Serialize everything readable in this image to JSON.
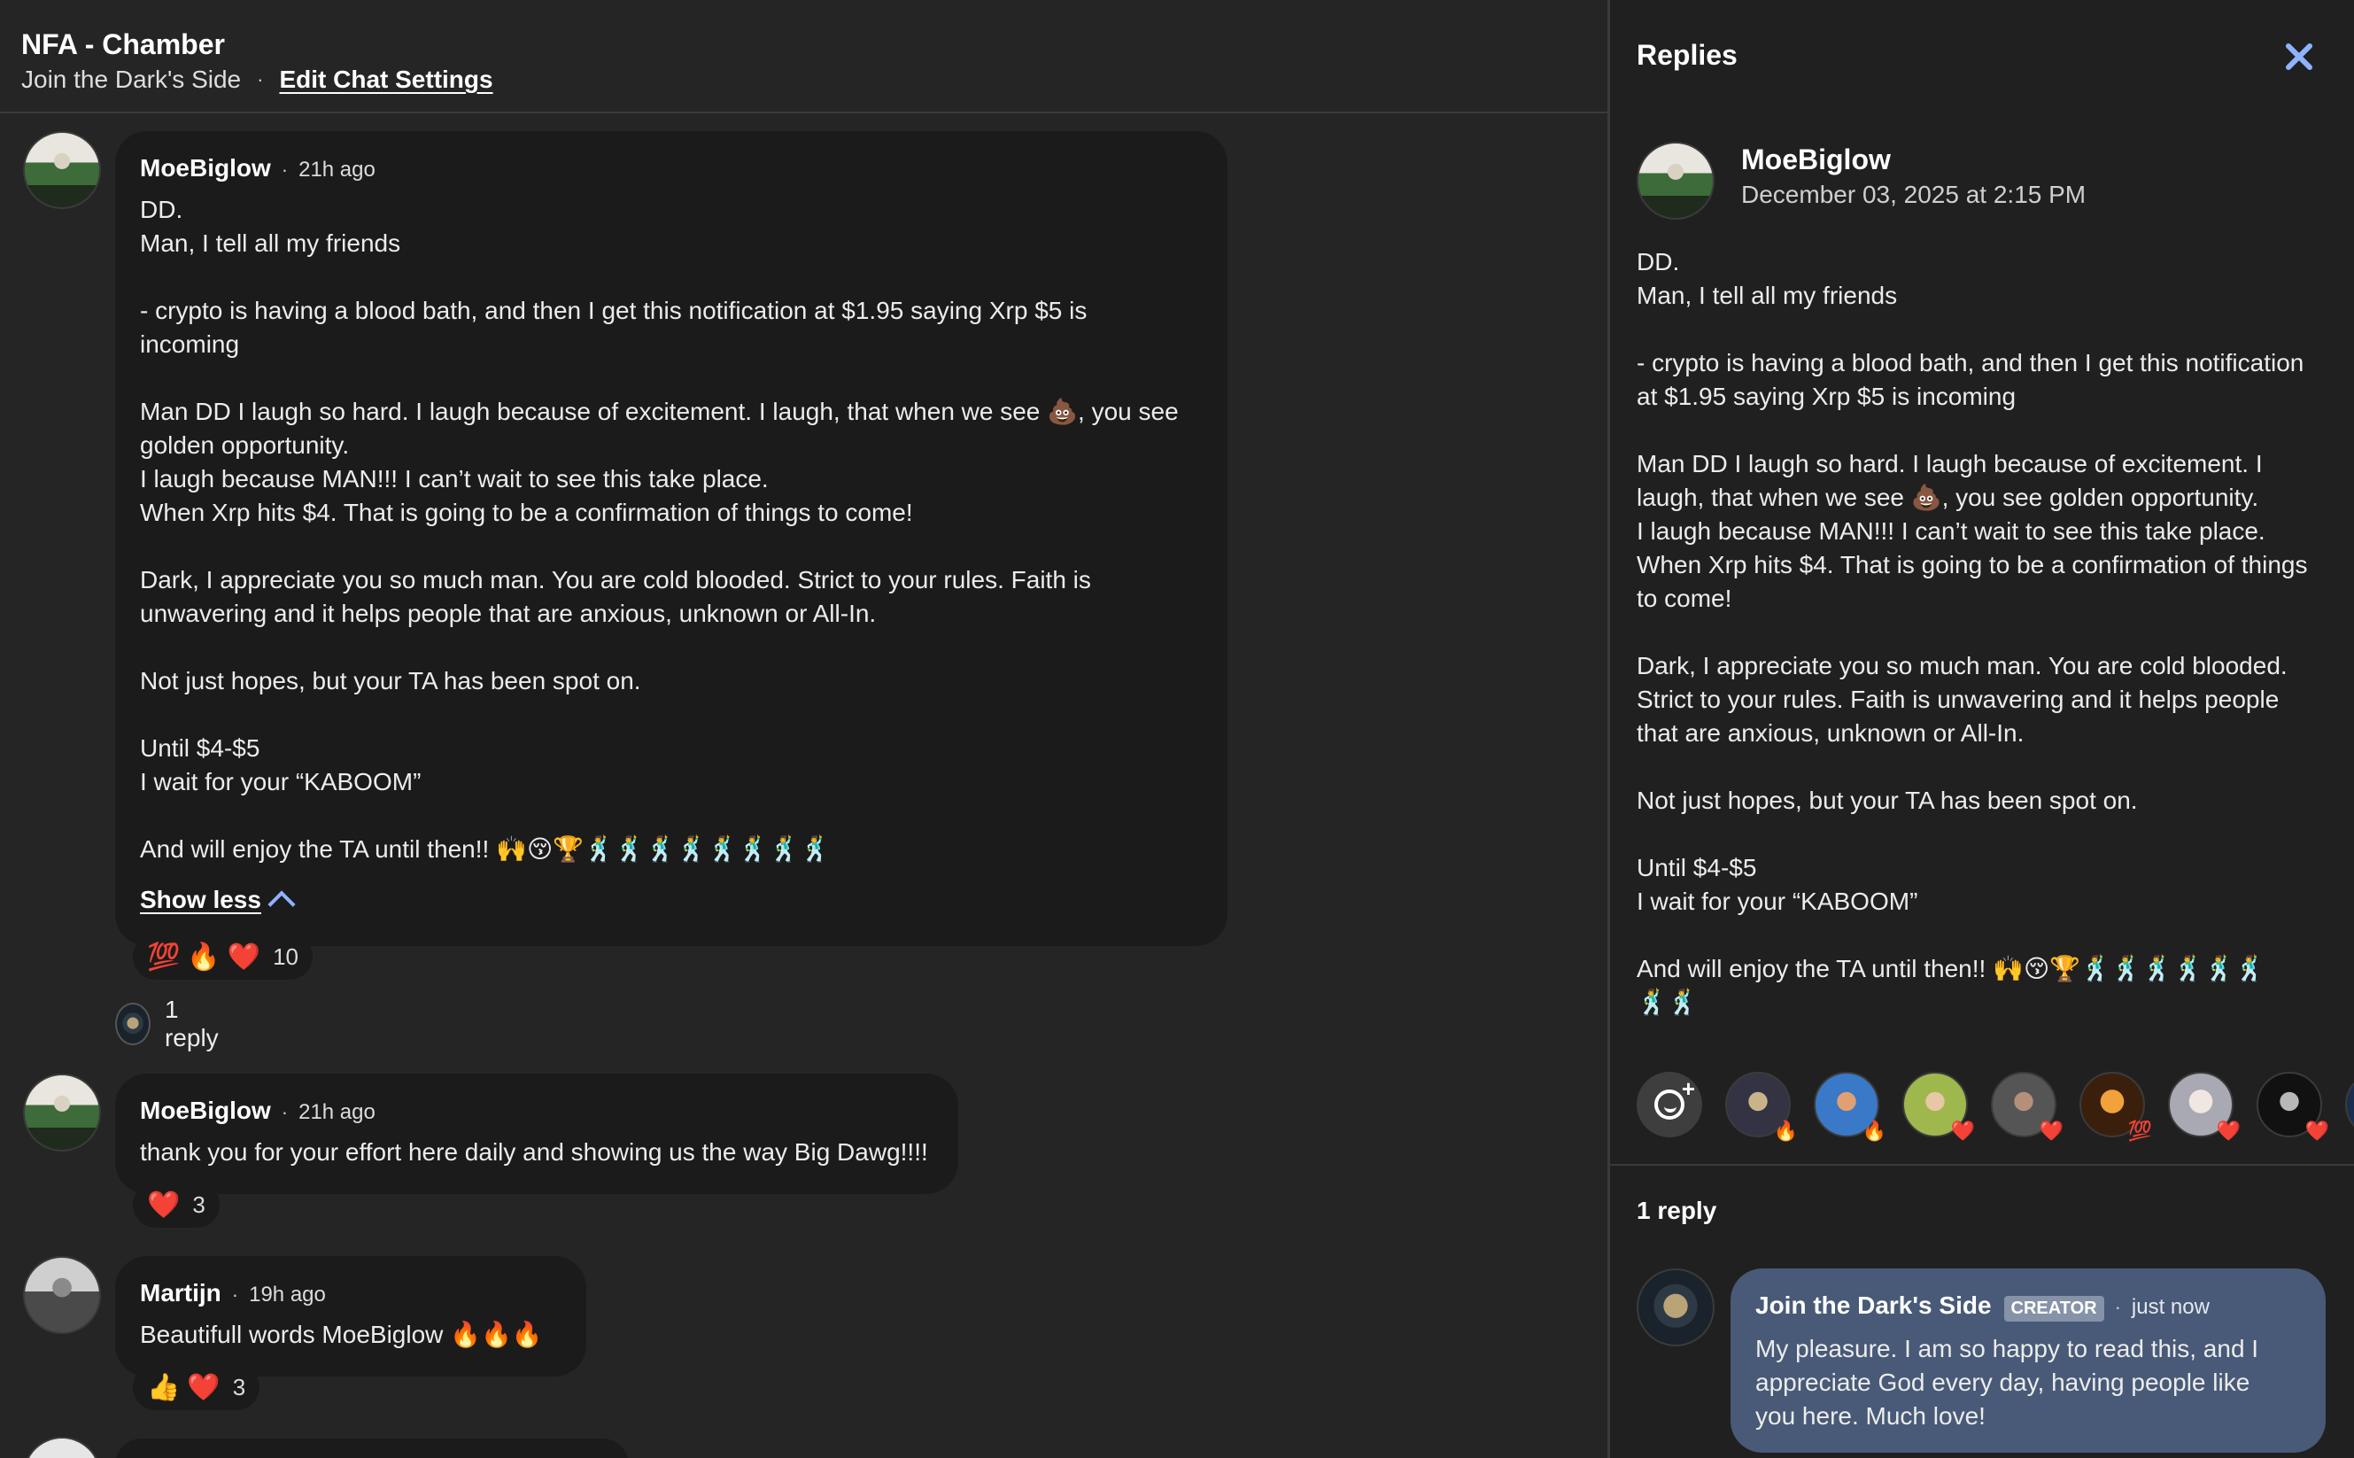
{
  "chat": {
    "title": "NFA - Chamber",
    "community": "Join the Dark's Side",
    "separator": "·",
    "edit_settings": "Edit Chat Settings"
  },
  "messages": [
    {
      "author": "MoeBiglow",
      "time": "21h ago",
      "lines": [
        "DD.",
        "Man, I tell all my friends",
        "",
        "- crypto is having a blood bath, and then I get this notification at $1.95 saying Xrp $5 is",
        "incoming",
        "",
        "Man DD I laugh so hard. I laugh because of excitement. I laugh, that when we see 💩, you see",
        "golden opportunity.",
        "I laugh because MAN!!! I can’t wait to see this take place.",
        "When Xrp hits $4. That is going to be a confirmation of things to come!",
        "",
        "Dark, I appreciate you so much man. You are cold blooded. Strict to your rules. Faith is",
        "unwavering and it helps people that are anxious, unknown or All-In.",
        "",
        "Not just hopes, but your TA has been spot on.",
        "",
        "Until $4-$5",
        "I wait for your “KABOOM”",
        "",
        "And will enjoy the TA until then!! 🙌😚🏆🕺🕺🕺🕺🕺🕺🕺🕺"
      ],
      "show_less": "Show less",
      "reactions": {
        "emojis": [
          "💯",
          "🔥",
          "❤️"
        ],
        "count": "10"
      },
      "reply_label": "1 reply"
    },
    {
      "author": "MoeBiglow",
      "time": "21h ago",
      "lines": [
        "thank you for your effort here daily and showing us the way Big Dawg!!!!"
      ],
      "reactions": {
        "emojis": [
          "❤️"
        ],
        "count": "3"
      }
    },
    {
      "author": "Martijn",
      "time": "19h ago",
      "lines": [
        "Beautifull words MoeBiglow 🔥🔥🔥"
      ],
      "reactions": {
        "emojis": [
          "👍",
          "❤️"
        ],
        "count": "3"
      }
    }
  ],
  "replies_panel": {
    "title": "Replies",
    "parent": {
      "author": "MoeBiglow",
      "date": "December 03, 2025 at 2:15 PM",
      "lines": [
        "DD.",
        "Man, I tell all my friends",
        "",
        "- crypto is having a blood bath, and then I get this notification",
        "at $1.95 saying Xrp $5 is incoming",
        "",
        "Man DD I laugh so hard. I laugh because of excitement. I",
        "laugh, that when we see 💩, you see golden opportunity.",
        "I laugh because MAN!!! I can’t wait to see this take place.",
        "When Xrp hits $4. That is going to be a confirmation of things",
        "to come!",
        "",
        "Dark, I appreciate you so much man. You are cold blooded.",
        "Strict to your rules. Faith is unwavering and it helps people",
        "that are anxious, unknown or All-In.",
        "",
        "Not just hopes, but your TA has been spot on.",
        "",
        "Until $4-$5",
        "I wait for your “KABOOM”",
        "",
        "And will enjoy the TA until then!! 🙌😚🏆🕺🕺🕺🕺🕺🕺",
        "🕺🕺"
      ]
    },
    "reactor_badges": [
      "🔥",
      "🔥",
      "❤️",
      "❤️",
      "💯",
      "❤️",
      "❤️",
      ""
    ],
    "reply_count": "1 reply",
    "reply": {
      "author": "Join the Dark's Side",
      "badge": "CREATOR",
      "time": "just now",
      "lines": [
        "My pleasure. I am so happy to read this, and I",
        "appreciate God every day, having people like",
        "you here. Much love!"
      ]
    }
  },
  "colors": {
    "background": "#252525",
    "bubble": "#1b1b1b",
    "panel": "#202020",
    "accent": "#8fb3ff",
    "creator_bubble": "#485a77"
  }
}
